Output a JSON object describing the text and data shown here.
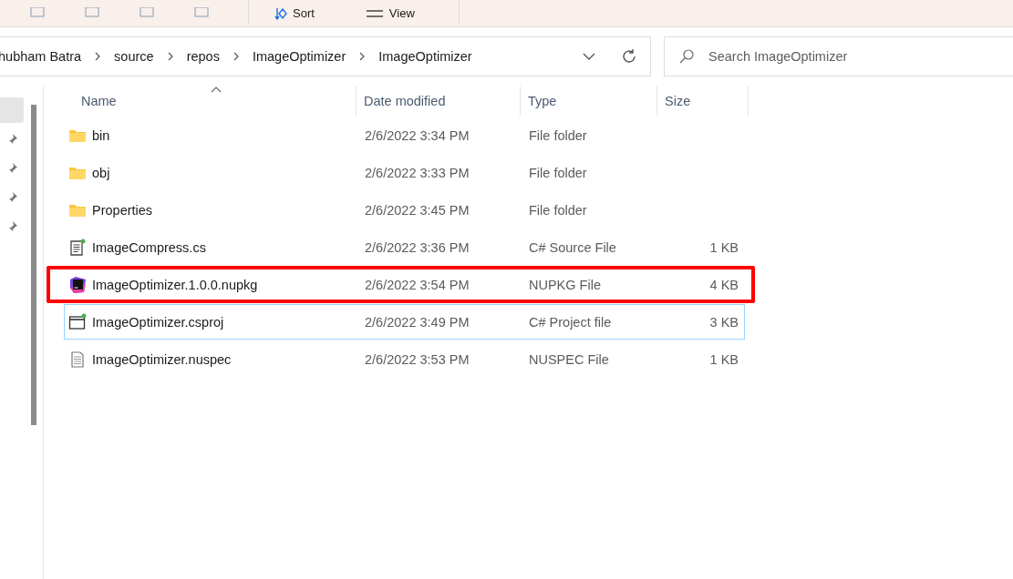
{
  "toolbar": {
    "buttons": [
      {
        "kind": "sort",
        "label": "Sort"
      },
      {
        "kind": "view",
        "label": "View"
      }
    ]
  },
  "address_bar": {
    "breadcrumbs": [
      "hubham Batra",
      "source",
      "repos",
      "ImageOptimizer",
      "ImageOptimizer"
    ]
  },
  "search": {
    "placeholder": "Search ImageOptimizer"
  },
  "nav_pane": {
    "items": [
      {
        "kind": "blank",
        "selected": true
      },
      {
        "kind": "pin",
        "selected": false
      },
      {
        "kind": "pin",
        "selected": false
      },
      {
        "kind": "pin",
        "selected": false
      },
      {
        "kind": "pin",
        "selected": false
      }
    ]
  },
  "table": {
    "columns": [
      "Name",
      "Date modified",
      "Type",
      "Size"
    ],
    "rows": [
      {
        "kind": "folder",
        "name": "bin",
        "date": "2/6/2022 3:34 PM",
        "type": "File folder",
        "selected": false,
        "highlighted": false
      },
      {
        "kind": "folder",
        "name": "obj",
        "date": "2/6/2022 3:33 PM",
        "type": "File folder",
        "selected": false,
        "highlighted": false
      },
      {
        "kind": "folder",
        "name": "Properties",
        "date": "2/6/2022 3:45 PM",
        "type": "File folder",
        "selected": false,
        "highlighted": false
      },
      {
        "kind": "cs",
        "name": "ImageCompress.cs",
        "date": "2/6/2022 3:36 PM",
        "type": "C# Source File",
        "size": "1 KB",
        "selected": false,
        "highlighted": false
      },
      {
        "kind": "nupkg",
        "name": "ImageOptimizer.1.0.0.nupkg",
        "date": "2/6/2022 3:54 PM",
        "type": "NUPKG File",
        "size": "4 KB",
        "selected": false,
        "highlighted": true
      },
      {
        "kind": "csproj",
        "name": "ImageOptimizer.csproj",
        "date": "2/6/2022 3:49 PM",
        "type": "C# Project file",
        "size": "3 KB",
        "selected": true,
        "highlighted": false
      },
      {
        "kind": "nuspec",
        "name": "ImageOptimizer.nuspec",
        "date": "2/6/2022 3:53 PM",
        "type": "NUSPEC File",
        "size": "1 KB",
        "selected": false,
        "highlighted": false
      }
    ]
  }
}
